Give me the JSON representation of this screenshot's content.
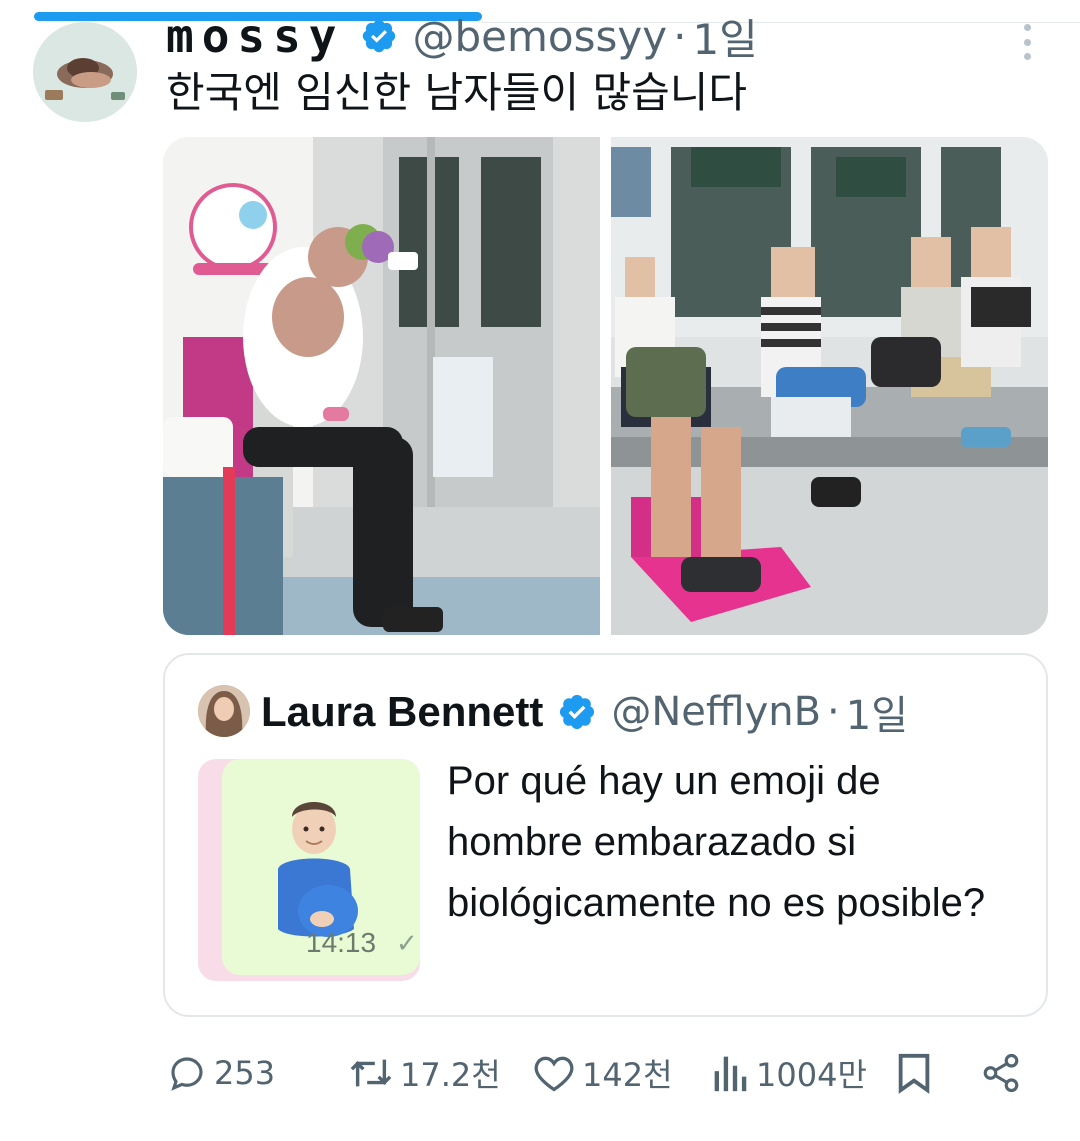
{
  "tweet": {
    "display_name": "mossy",
    "handle": "@bemossyy",
    "separator": "·",
    "time": "1일",
    "text": "한국엔 임신한 남자들이 많습니다"
  },
  "media": {
    "photos": [
      "subway-photo-left",
      "subway-photo-right"
    ]
  },
  "quote": {
    "display_name": "Laura Bennett",
    "handle": "@NefflynB",
    "separator": "·",
    "time": "1일",
    "text": "Por qué hay un emoji de hombre embarazado si biológicamente no es posible?",
    "thumbnail": {
      "emoji": "🫃🏻",
      "time": "14:13"
    }
  },
  "actions": {
    "reply_count": "253",
    "retweet_count": "17.2천",
    "like_count": "142천",
    "view_count": "1004만"
  },
  "colors": {
    "accent": "#1d9bf0",
    "secondary_text": "#536471",
    "border": "#e3e7ea"
  },
  "icons": [
    "verified-icon",
    "more-icon",
    "reply-icon",
    "retweet-icon",
    "like-icon",
    "views-icon",
    "bookmark-icon",
    "share-icon"
  ]
}
